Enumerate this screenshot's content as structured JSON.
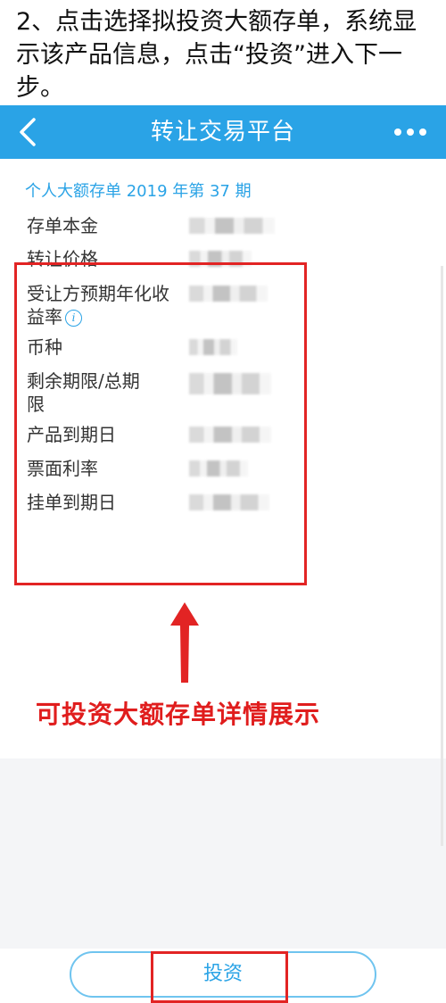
{
  "caption": "2、点击选择拟投资大额存单，系统显示该产品信息，点击“投资”进入下一步。",
  "header": {
    "back_icon": "chevron-left-icon",
    "title": "转让交易平台",
    "more_icon": "more-dots-icon",
    "color": "#2aa3e6"
  },
  "product": {
    "title": "个人大额存单 2019 年第 37 期",
    "fields": [
      {
        "label": "存单本金"
      },
      {
        "label": "转让价格"
      },
      {
        "label": "受让方预期年化收益率",
        "info_icon": "info-icon"
      },
      {
        "label": "币种"
      },
      {
        "label": "剩余期限/总期限"
      },
      {
        "label": "产品到期日"
      },
      {
        "label": "票面利率"
      },
      {
        "label": "挂单到期日"
      }
    ]
  },
  "annotation": {
    "text": "可投资大额存单详情展示",
    "color": "#e01d1d"
  },
  "footer": {
    "invest_label": "投资"
  }
}
